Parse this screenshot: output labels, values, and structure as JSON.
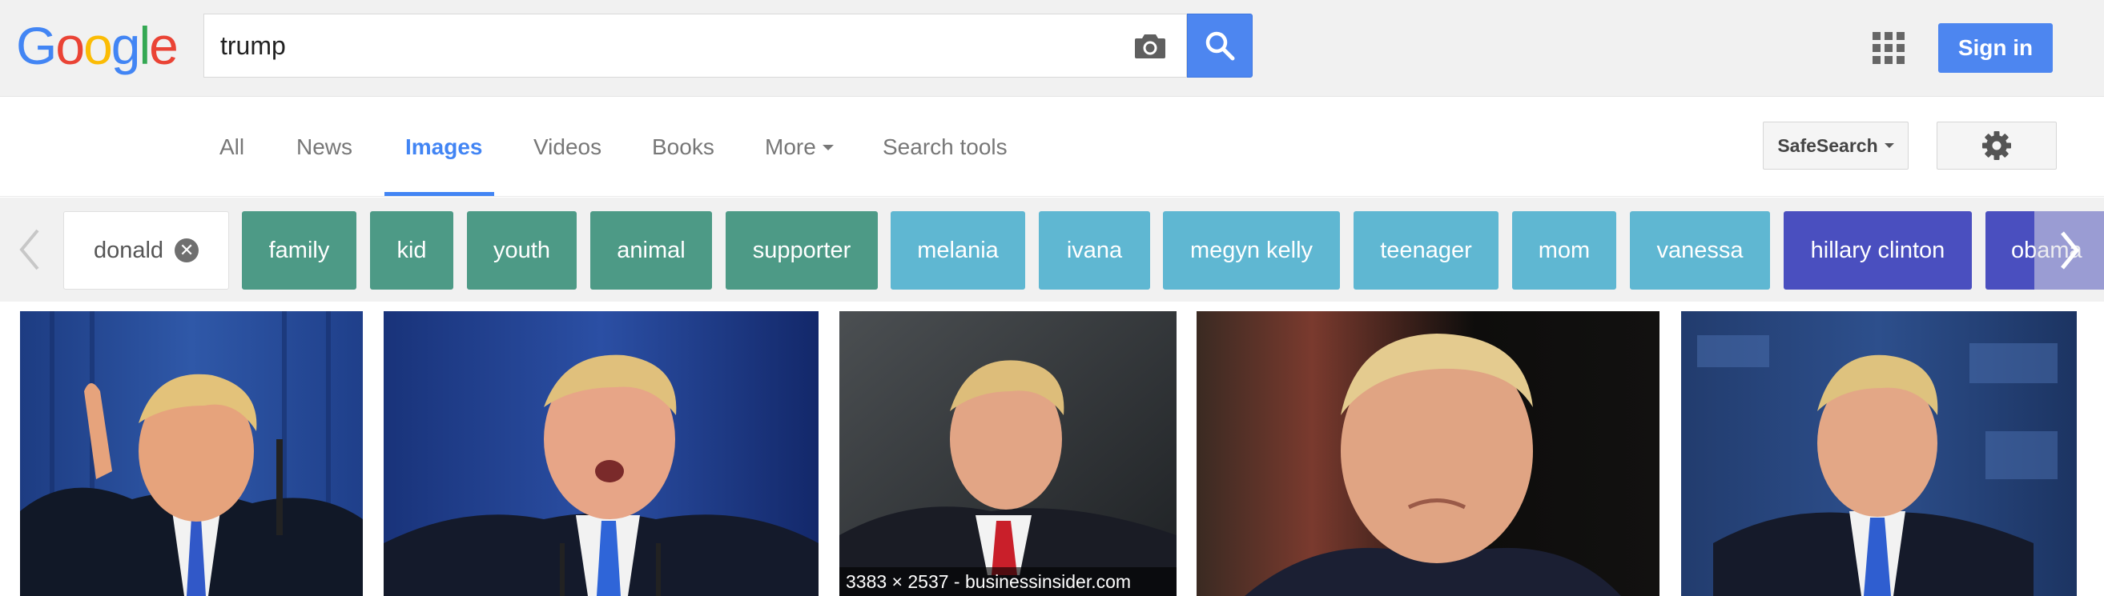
{
  "header": {
    "logo_letters": [
      {
        "char": "G",
        "color": "#4285f4"
      },
      {
        "char": "o",
        "color": "#ea4335"
      },
      {
        "char": "o",
        "color": "#fbbc05"
      },
      {
        "char": "g",
        "color": "#4285f4"
      },
      {
        "char": "l",
        "color": "#34a853"
      },
      {
        "char": "e",
        "color": "#ea4335"
      }
    ],
    "search_value": "trump",
    "signin_label": "Sign in",
    "accent_color": "#4d86f0"
  },
  "tabs": {
    "items": [
      {
        "label": "All"
      },
      {
        "label": "News"
      },
      {
        "label": "Images"
      },
      {
        "label": "Videos"
      },
      {
        "label": "Books"
      },
      {
        "label": "More"
      },
      {
        "label": "Search tools"
      }
    ],
    "active": "Images",
    "safesearch_label": "SafeSearch"
  },
  "chips": {
    "items": [
      {
        "label": "donald",
        "color": "#ffffff",
        "selected": true
      },
      {
        "label": "family",
        "color": "#4d9a86"
      },
      {
        "label": "kid",
        "color": "#4d9a86"
      },
      {
        "label": "youth",
        "color": "#4d9a86"
      },
      {
        "label": "animal",
        "color": "#4d9a86"
      },
      {
        "label": "supporter",
        "color": "#4d9a86"
      },
      {
        "label": "melania",
        "color": "#5fb7d2"
      },
      {
        "label": "ivana",
        "color": "#5fb7d2"
      },
      {
        "label": "megyn kelly",
        "color": "#5fb7d2"
      },
      {
        "label": "teenager",
        "color": "#5fb7d2"
      },
      {
        "label": "mom",
        "color": "#5fb7d2"
      },
      {
        "label": "vanessa",
        "color": "#5fb7d2"
      },
      {
        "label": "hillary clinton",
        "color": "#4a4fbf"
      },
      {
        "label": "obama",
        "color": "#4a4fbf"
      }
    ]
  },
  "results": {
    "thumbnails": [
      {
        "name": "result-image-1"
      },
      {
        "name": "result-image-2"
      },
      {
        "name": "result-image-3",
        "caption": "3383 × 2537 - businessinsider.com"
      },
      {
        "name": "result-image-4"
      },
      {
        "name": "result-image-5"
      }
    ]
  }
}
